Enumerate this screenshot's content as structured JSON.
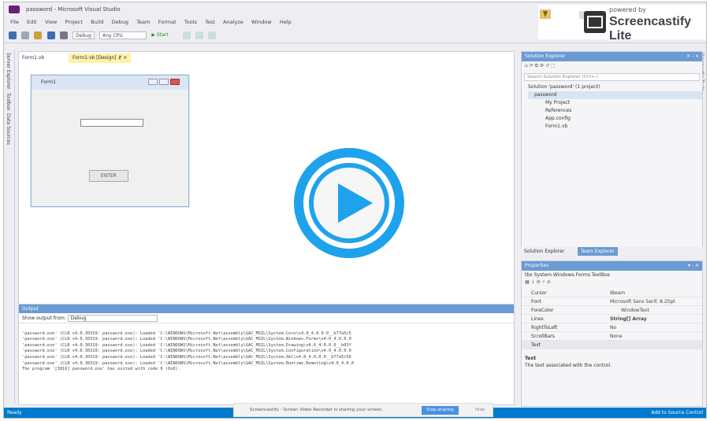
{
  "window": {
    "title": "password - Microsoft Visual Studio"
  },
  "menu": [
    "File",
    "Edit",
    "View",
    "Project",
    "Build",
    "Debug",
    "Team",
    "Format",
    "Tools",
    "Test",
    "Analyze",
    "Window",
    "Help"
  ],
  "toolbar": {
    "config": "Debug",
    "platform": "Any CPU",
    "start": "Start"
  },
  "left_strip": [
    "Server Explorer",
    "Toolbox",
    "Data Sources"
  ],
  "right_strip": "Diagnostic Tools",
  "doc_tabs": [
    {
      "label": "Form1.vb"
    },
    {
      "label": "Form1.vb [Design]"
    }
  ],
  "form": {
    "title": "Form1",
    "button_label": "ENTER"
  },
  "solution_explorer": {
    "title": "Solution Explorer",
    "search_placeholder": "Search Solution Explorer (Ctrl+;)",
    "items": [
      "Solution 'password' (1 project)",
      "password",
      "My Project",
      "References",
      "App.config",
      "Form1.vb"
    ],
    "tabs": [
      "Solution Explorer",
      "Team Explorer"
    ]
  },
  "properties": {
    "title": "Properties",
    "object": "tbx System.Windows.Forms.TextBox",
    "rows": [
      {
        "key": "Cursor",
        "value": "IBeam"
      },
      {
        "key": "Font",
        "value": "Microsoft Sans Serif, 8.25pt"
      },
      {
        "key": "ForeColor",
        "value": "WindowText"
      },
      {
        "key": "Lines",
        "value": "String[] Array"
      },
      {
        "key": "RightToLeft",
        "value": "No"
      },
      {
        "key": "ScrollBars",
        "value": "None"
      },
      {
        "key": "Text",
        "value": ""
      }
    ],
    "desc_title": "Text",
    "desc": "The text associated with the control."
  },
  "output": {
    "title": "Output",
    "show_from_label": "Show output from:",
    "show_from_value": "Debug",
    "lines": [
      "'password.exe' (CLR v4.0.30319: password.exe): Loaded 'C:\\WINDOWS\\Microsoft.Net\\assembly\\GAC_MSIL\\System.Core\\v4.0_4.0.0.0__b77a5c5",
      "'password.exe' (CLR v4.0.30319: password.exe): Loaded 'C:\\WINDOWS\\Microsoft.Net\\assembly\\GAC_MSIL\\System.Windows.Forms\\v4.0_4.0.0.0",
      "'password.exe' (CLR v4.0.30319: password.exe): Loaded 'C:\\WINDOWS\\Microsoft.Net\\assembly\\GAC_MSIL\\System.Drawing\\v4.0_4.0.0.0__b03f",
      "'password.exe' (CLR v4.0.30319: password.exe): Loaded 'C:\\WINDOWS\\Microsoft.Net\\assembly\\GAC_MSIL\\System.Configuration\\v4.0_4.0.0.0",
      "'password.exe' (CLR v4.0.30319: password.exe): Loaded 'C:\\WINDOWS\\Microsoft.Net\\assembly\\GAC_MSIL\\System.Xml\\v4.0_4.0.0.0__b77a5c56",
      "'password.exe' (CLR v4.0.30319: password.exe): Loaded 'C:\\WINDOWS\\Microsoft.Net\\assembly\\GAC_MSIL\\System.Runtime.Remoting\\v4.0_4.0.0",
      "The program '[3816] password.exe' has exited with code 0 (0x0)."
    ]
  },
  "status": {
    "left": "Ready",
    "right": "Add to Source Control"
  },
  "screencast": {
    "bar_text": "Screencastify - Screen Video Recorder is sharing your screen.",
    "stop_label": "Stop sharing",
    "hide_label": "Hide",
    "brand_small": "powered by",
    "brand_large": "Screencastify Lite"
  },
  "colors": {
    "accent": "#007acc",
    "play": "#1fa2ec",
    "panel_header": "#6a9bd2"
  }
}
